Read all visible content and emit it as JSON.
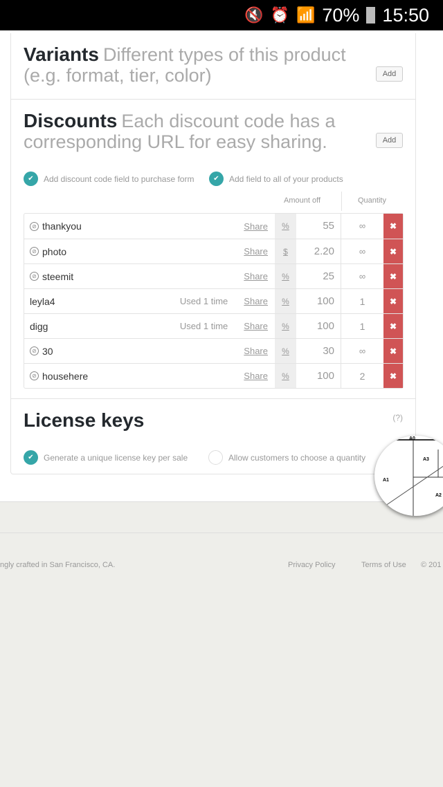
{
  "status_bar": {
    "battery": "70%",
    "time": "15:50",
    "icons": [
      "mute-icon",
      "alarm-icon",
      "wifi-icon",
      "signal-icon",
      "battery-icon"
    ]
  },
  "variants": {
    "title": "Variants",
    "description": "Different types of this product (e.g. format, tier, color)",
    "add_label": "Add"
  },
  "discounts": {
    "title": "Discounts",
    "description": "Each discount code has a corresponding URL for easy sharing.",
    "add_label": "Add",
    "options": [
      {
        "label": "Add discount code field to purchase form",
        "checked": true
      },
      {
        "label": "Add field to all of your products",
        "checked": true
      }
    ],
    "columns": {
      "amount": "Amount off",
      "quantity": "Quantity"
    },
    "rows": [
      {
        "code": "thankyou",
        "icon": true,
        "used": "",
        "share": "Share",
        "unit": "%",
        "amount": "55",
        "quantity": "∞"
      },
      {
        "code": "photo",
        "icon": true,
        "used": "",
        "share": "Share",
        "unit": "$",
        "amount": "2.20",
        "quantity": "∞"
      },
      {
        "code": "steemit",
        "icon": true,
        "used": "",
        "share": "Share",
        "unit": "%",
        "amount": "25",
        "quantity": "∞"
      },
      {
        "code": "leyla4",
        "icon": false,
        "used": "Used 1 time",
        "share": "Share",
        "unit": "%",
        "amount": "100",
        "quantity": "1"
      },
      {
        "code": "digg",
        "icon": false,
        "used": "Used 1 time",
        "share": "Share",
        "unit": "%",
        "amount": "100",
        "quantity": "1"
      },
      {
        "code": "30",
        "icon": true,
        "used": "",
        "share": "Share",
        "unit": "%",
        "amount": "30",
        "quantity": "∞"
      },
      {
        "code": "househere",
        "icon": true,
        "used": "",
        "share": "Share",
        "unit": "%",
        "amount": "100",
        "quantity": "2"
      }
    ],
    "delete_glyph": "✖"
  },
  "license": {
    "title": "License keys",
    "help": "(?)",
    "options": [
      {
        "label": "Generate a unique license key per sale",
        "checked": true
      },
      {
        "label": "Allow customers to choose a quantity",
        "checked": false
      }
    ]
  },
  "magnifier": {
    "labels": [
      "A0",
      "A1",
      "A2",
      "A3"
    ]
  },
  "footer": {
    "crafted": "ngly crafted in San Francisco, CA.",
    "privacy": "Privacy Policy",
    "terms": "Terms of Use",
    "copyright": "© 201"
  },
  "colors": {
    "accent": "#35a6a8",
    "danger": "#d05455"
  }
}
